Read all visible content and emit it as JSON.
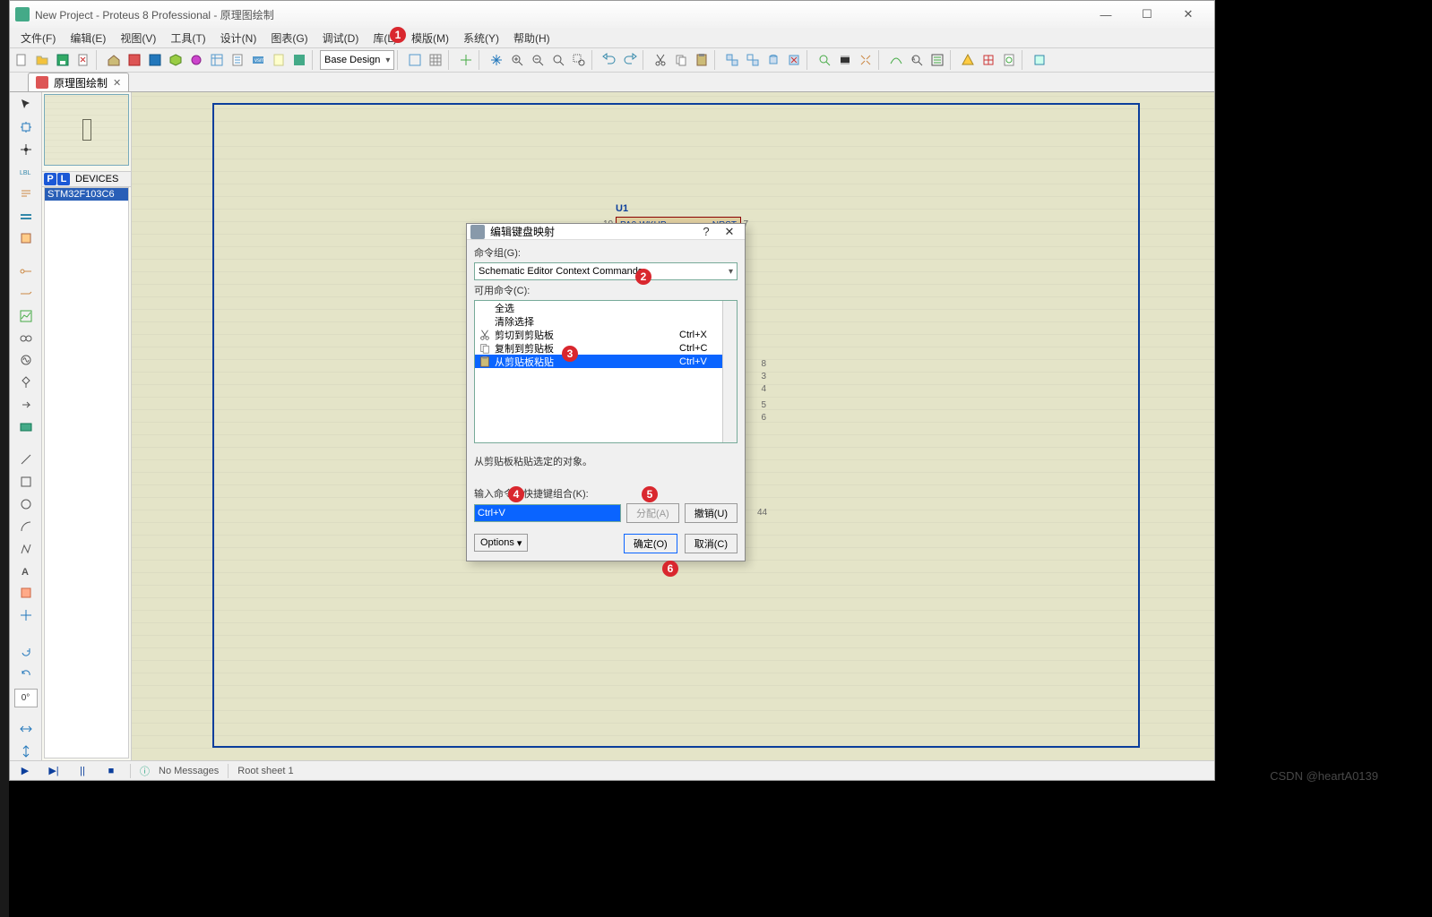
{
  "title": "New Project - Proteus 8 Professional - 原理图绘制",
  "menus": [
    "文件(F)",
    "编辑(E)",
    "视图(V)",
    "工具(T)",
    "设计(N)",
    "图表(G)",
    "调试(D)",
    "库(L)",
    "模版(M)",
    "系统(Y)",
    "帮助(H)"
  ],
  "design_dd": "Base Design",
  "tab": {
    "label": "原理图绘制"
  },
  "devices": {
    "header": "DEVICES",
    "item": "STM32F103C6"
  },
  "component": {
    "ref": "U1",
    "pinL_name": "PA0-WKUP",
    "pinR_name": "NRST",
    "pinL_num": "10",
    "pinR_num": "7"
  },
  "pins_right": [
    "8",
    "3",
    "4",
    "5",
    "6",
    "44"
  ],
  "status": {
    "nomsg": "No Messages",
    "sheet": "Root sheet 1"
  },
  "watermark": "CSDN @heartA0139",
  "rotation": "0°",
  "dialog": {
    "title": "编辑键盘映射",
    "group_label": "命令组(G):",
    "group_value": "Schematic Editor Context Commands",
    "avail_label": "可用命令(C):",
    "items": [
      {
        "label": "全选",
        "sc": ""
      },
      {
        "label": "清除选择",
        "sc": ""
      },
      {
        "label": "剪切到剪贴板",
        "sc": "Ctrl+X",
        "icon": "cut"
      },
      {
        "label": "复制到剪贴板",
        "sc": "Ctrl+C",
        "icon": "copy"
      },
      {
        "label": "从剪贴板粘贴",
        "sc": "Ctrl+V",
        "icon": "paste",
        "sel": true
      }
    ],
    "desc": "从剪贴板粘贴选定的对象。",
    "shortcut_label": "输入命令的快捷键组合(K):",
    "shortcut_value": "Ctrl+V",
    "assign": "分配(A)",
    "unassign": "撤销(U)",
    "options": "Options",
    "ok": "确定(O)",
    "cancel": "取消(C)"
  },
  "ann": {
    "1": "1",
    "2": "2",
    "3": "3",
    "4": "4",
    "5": "5",
    "6": "6"
  }
}
